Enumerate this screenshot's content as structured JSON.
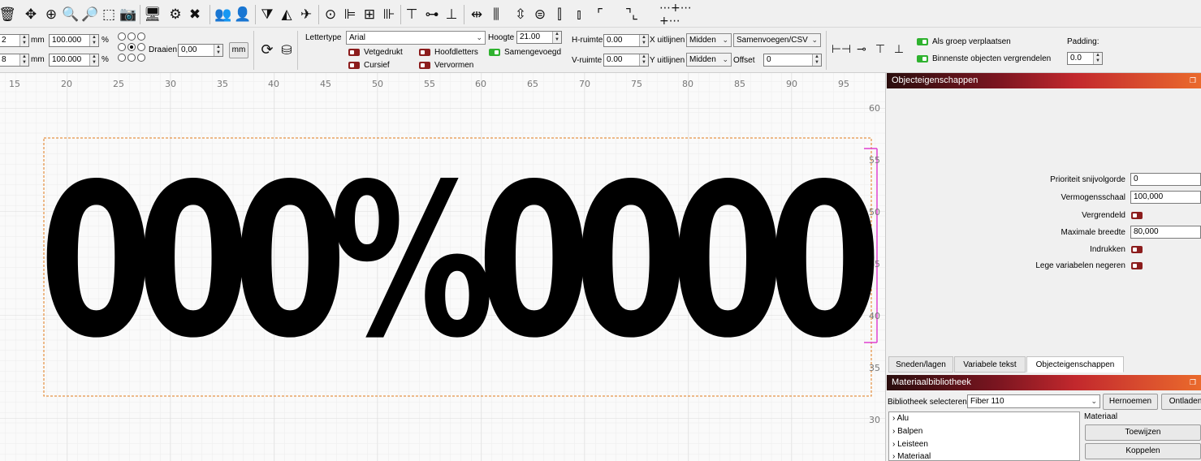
{
  "toolbar_main": {
    "icons": [
      "trash-icon",
      "move-icon",
      "zoom-special-icon",
      "zoom-in-icon",
      "zoom-out-icon",
      "select-rect-icon",
      "camera-icon",
      "monitor-icon",
      "gear-wrench-icon",
      "tools-icon",
      "users-group-icon",
      "user-icon",
      "flip-vertical-icon",
      "flip-horizontal-icon",
      "paper-plane-icon",
      "target-icon",
      "align-left-icon",
      "align-center-icon",
      "align-right-icon",
      "align-top-icon",
      "align-middle-icon",
      "align-bottom-icon",
      "distribute-h-icon",
      "distribute-space-icon",
      "distribute-v-icon",
      "distribute-center-icon",
      "distribute-right-icon",
      "corner-top-left-icon",
      "corner-bottom-right-icon",
      "grid-dots-icon"
    ]
  },
  "transform": {
    "row1": {
      "value": "2",
      "unit": "mm",
      "scale": "100.000",
      "pct": "%"
    },
    "row2": {
      "value": "8",
      "unit": "mm",
      "scale": "100.000",
      "pct": "%"
    },
    "rotate_label": "Draaien",
    "rotate_value": "0,00",
    "unit_button": "mm"
  },
  "text_props": {
    "font_label": "Lettertype",
    "font_value": "Arial",
    "height_label": "Hoogte",
    "height_value": "21.00",
    "bold": "Vetgedrukt",
    "italic": "Cursief",
    "caps": "Hoofdletters",
    "distort": "Vervormen",
    "welded": "Samengevoegd",
    "h_space_label": "H-ruimte",
    "h_space_value": "0.00",
    "v_space_label": "V-ruimte",
    "v_space_value": "0.00",
    "x_align_label": "X uitlijnen",
    "x_align_value": "Midden",
    "y_align_label": "Y uitlijnen",
    "y_align_value": "Midden",
    "merge_value": "Samenvoegen/CSV",
    "offset_label": "Offset",
    "offset_value": "0"
  },
  "group_props": {
    "move_as_group": "Als groep verplaatsen",
    "lock_inner": "Binnenste objecten vergrendelen",
    "padding_label": "Padding:",
    "padding_value": "0.0"
  },
  "ruler": {
    "top_labels": [
      "15",
      "20",
      "25",
      "30",
      "35",
      "40",
      "45",
      "50",
      "55",
      "60",
      "65",
      "70",
      "75",
      "80",
      "85",
      "90",
      "95"
    ],
    "side_labels": [
      "60",
      "55",
      "50",
      "45",
      "40",
      "35",
      "30"
    ]
  },
  "canvas_text": "000%0000",
  "object_props": {
    "title": "Objecteigenschappen",
    "priority_label": "Prioriteit snijvolgorde",
    "priority_value": "0",
    "power_label": "Vermogensschaal",
    "power_value": "100,000",
    "locked_label": "Vergrendeld",
    "max_width_label": "Maximale breedte",
    "max_width_value": "80,000",
    "indent_label": "Indrukken",
    "ignore_empty_label": "Lege variabelen negeren"
  },
  "tabs": [
    "Sneden/lagen",
    "Variabele tekst",
    "Objecteigenschappen"
  ],
  "material": {
    "title": "Materiaalbibliotheek",
    "select_label": "Bibliotheek selecteren",
    "select_value": "Fiber 110",
    "rename_btn": "Hernoemen",
    "unload_btn": "Ontladen",
    "tree_items": [
      "Alu",
      "Balpen",
      "Leisteen",
      "Materiaal"
    ],
    "material_label": "Materiaal",
    "assign_btn": "Toewijzen",
    "link_btn": "Koppelen"
  }
}
